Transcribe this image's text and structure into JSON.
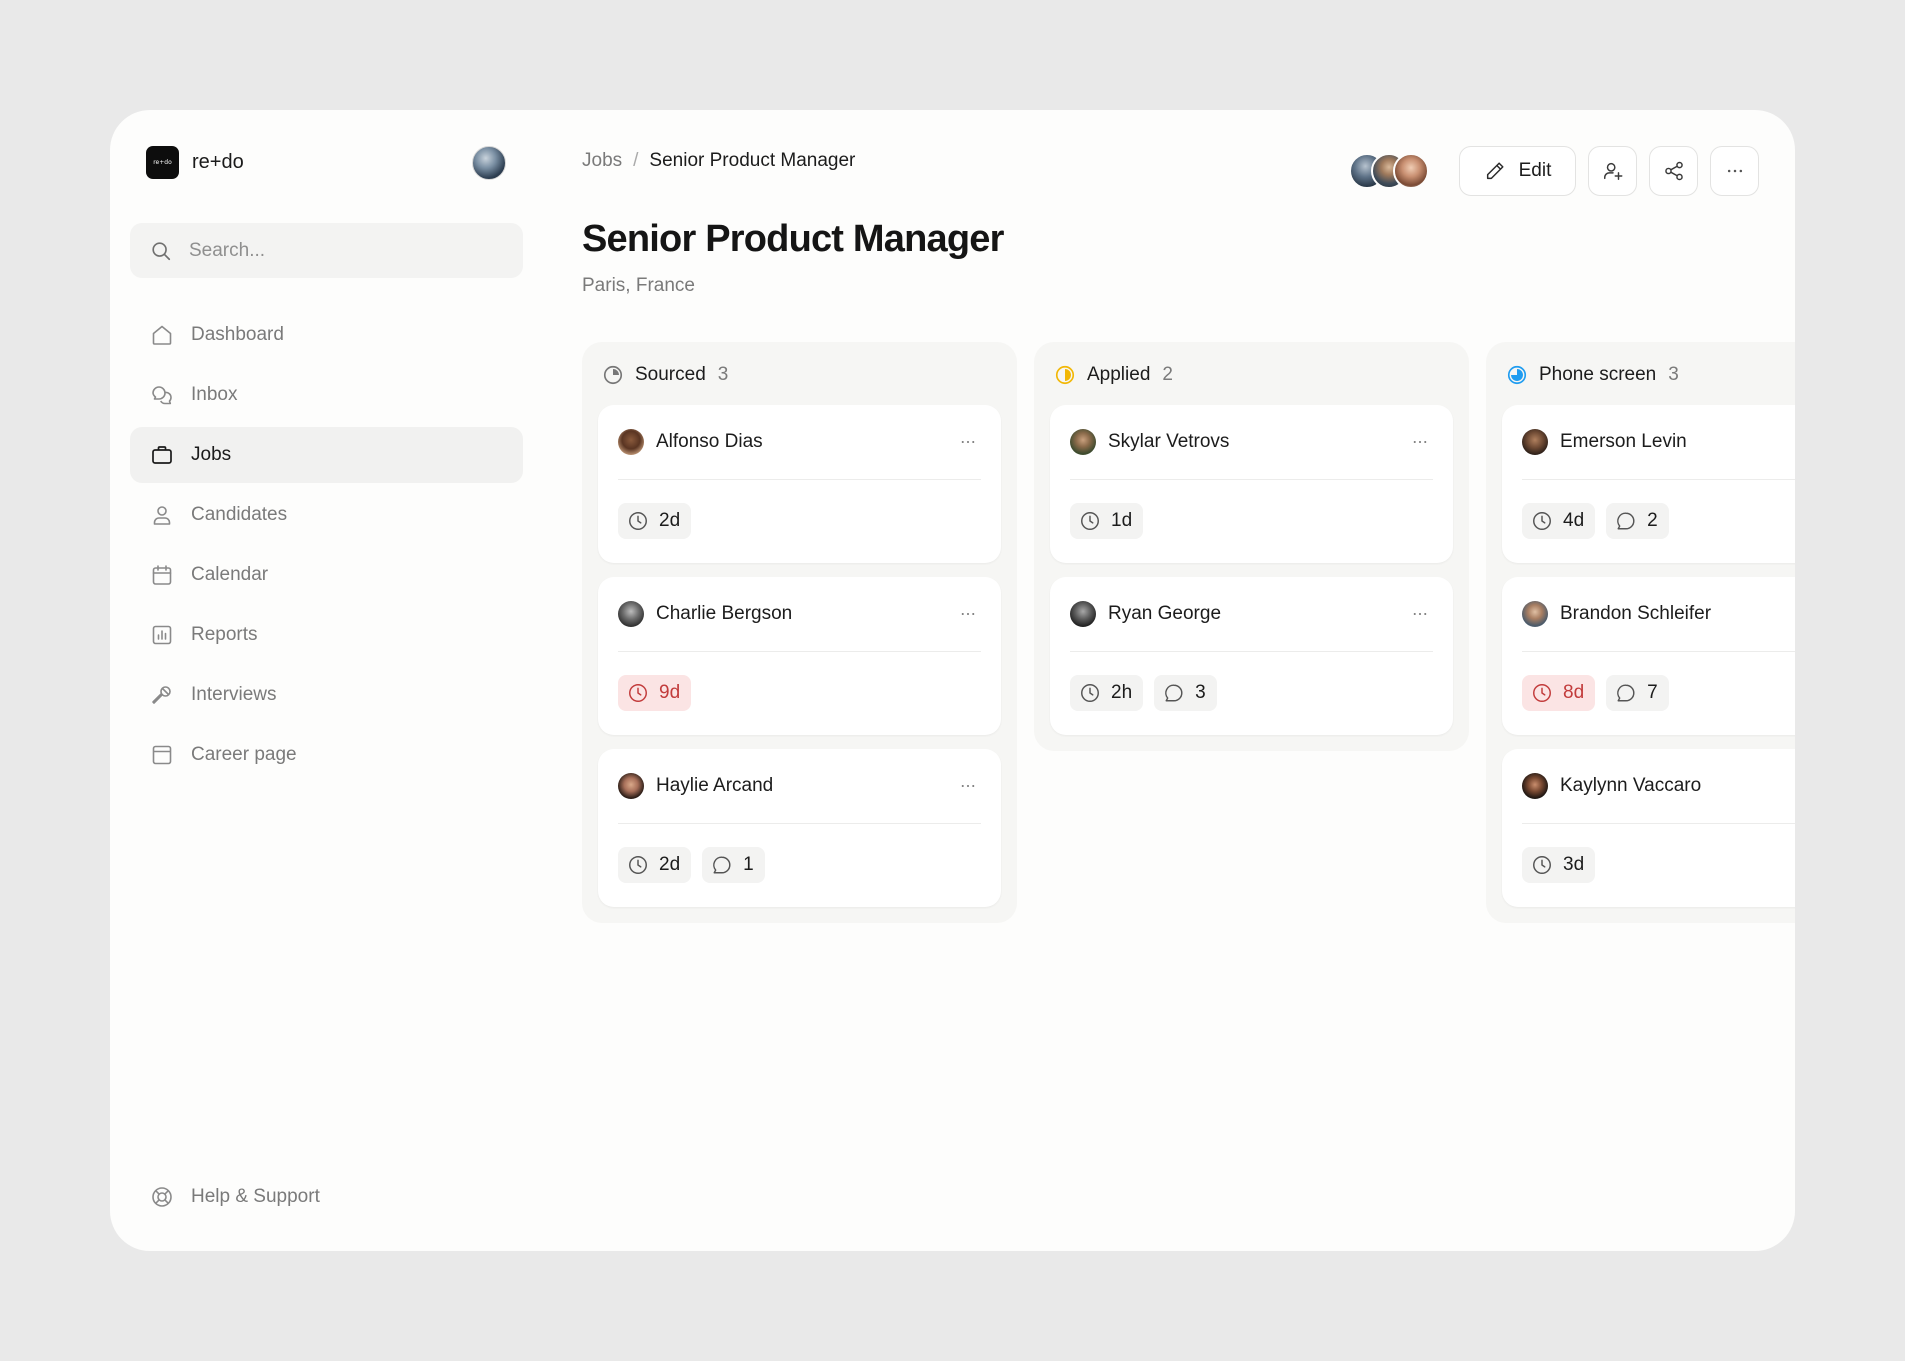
{
  "app": {
    "logo_text": "re+do",
    "name": "re+do"
  },
  "search": {
    "placeholder": "Search..."
  },
  "nav": [
    {
      "label": "Dashboard",
      "icon": "home-icon",
      "active": false
    },
    {
      "label": "Inbox",
      "icon": "chat-bubbles-icon",
      "active": false
    },
    {
      "label": "Jobs",
      "icon": "briefcase-icon",
      "active": true
    },
    {
      "label": "Candidates",
      "icon": "person-icon",
      "active": false
    },
    {
      "label": "Calendar",
      "icon": "calendar-icon",
      "active": false
    },
    {
      "label": "Reports",
      "icon": "bar-chart-icon",
      "active": false
    },
    {
      "label": "Interviews",
      "icon": "microphone-icon",
      "active": false
    },
    {
      "label": "Career page",
      "icon": "browser-window-icon",
      "active": false
    }
  ],
  "help": {
    "label": "Help & Support",
    "icon": "lifebuoy-icon"
  },
  "breadcrumb": {
    "parent": "Jobs",
    "separator": "/",
    "current": "Senior Product Manager"
  },
  "page": {
    "title": "Senior Product Manager",
    "location": "Paris, France"
  },
  "toolbar": {
    "edit_label": "Edit",
    "icons": [
      "add-user-icon",
      "share-icon",
      "more-horizontal-icon"
    ]
  },
  "colors": {
    "overdue_bg": "#fbe4e4",
    "overdue_text": "#c23b3b",
    "applied_accent": "#f2b705",
    "phone_accent": "#1f9cf0"
  },
  "columns": [
    {
      "title": "Sourced",
      "count": "3",
      "icon": "progress-quarter-gray-icon",
      "cards": [
        {
          "name": "Alfonso Dias",
          "time": "2d",
          "overdue": false,
          "comments": null
        },
        {
          "name": "Charlie Bergson",
          "time": "9d",
          "overdue": true,
          "comments": null
        },
        {
          "name": "Haylie Arcand",
          "time": "2d",
          "overdue": false,
          "comments": "1"
        }
      ]
    },
    {
      "title": "Applied",
      "count": "2",
      "icon": "progress-half-yellow-icon",
      "cards": [
        {
          "name": "Skylar Vetrovs",
          "time": "1d",
          "overdue": false,
          "comments": null
        },
        {
          "name": "Ryan George",
          "time": "2h",
          "overdue": false,
          "comments": "3"
        }
      ]
    },
    {
      "title": "Phone screen",
      "count": "3",
      "icon": "progress-three-quarter-blue-icon",
      "cards": [
        {
          "name": "Emerson Levin",
          "time": "4d",
          "overdue": false,
          "comments": "2"
        },
        {
          "name": "Brandon Schleifer",
          "time": "8d",
          "overdue": true,
          "comments": "7"
        },
        {
          "name": "Kaylynn Vaccaro",
          "time": "3d",
          "overdue": false,
          "comments": null
        }
      ]
    }
  ]
}
